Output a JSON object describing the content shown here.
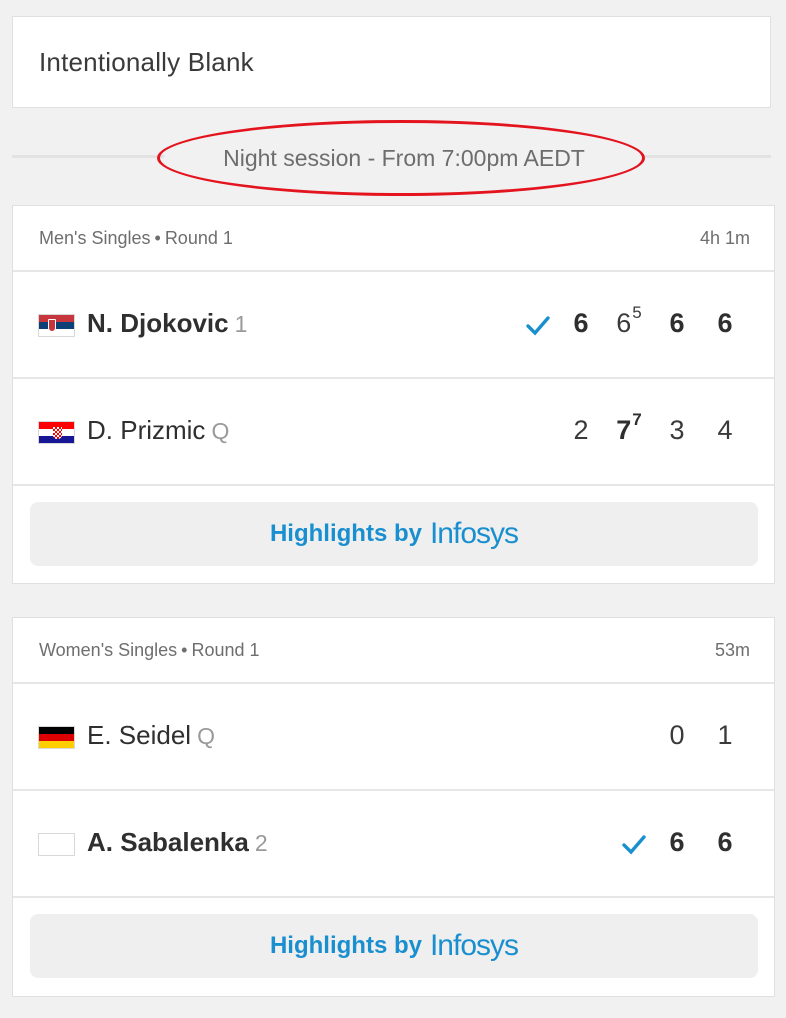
{
  "blank_card": {
    "text": "Intentionally Blank"
  },
  "session": {
    "label": "Night session - From 7:00pm AEDT"
  },
  "matches": [
    {
      "event": "Men's Singles",
      "round": "Round 1",
      "duration": "4h 1m",
      "players": [
        {
          "name": "N. Djokovic",
          "seed": "1",
          "country": "Serbia",
          "winner": true,
          "flag_colors": [
            "#c6363c",
            "#0c4076",
            "#ffffff"
          ],
          "sets": [
            {
              "games": "6",
              "tiebreak": ""
            },
            {
              "games": "6",
              "tiebreak": "5"
            },
            {
              "games": "6",
              "tiebreak": ""
            },
            {
              "games": "6",
              "tiebreak": ""
            }
          ],
          "set_won": [
            true,
            false,
            true,
            true
          ]
        },
        {
          "name": "D. Prizmic",
          "seed": "Q",
          "country": "Croatia",
          "winner": false,
          "flag_colors": [
            "#ff0000",
            "#ffffff",
            "#171796"
          ],
          "sets": [
            {
              "games": "2",
              "tiebreak": ""
            },
            {
              "games": "7",
              "tiebreak": "7"
            },
            {
              "games": "3",
              "tiebreak": ""
            },
            {
              "games": "4",
              "tiebreak": ""
            }
          ],
          "set_won": [
            false,
            true,
            false,
            false
          ]
        }
      ],
      "highlights": {
        "label": "Highlights by",
        "brand": "Infosys"
      }
    },
    {
      "event": "Women's Singles",
      "round": "Round 1",
      "duration": "53m",
      "players": [
        {
          "name": "E. Seidel",
          "seed": "Q",
          "country": "Germany",
          "winner": false,
          "flag_colors": [
            "#000000",
            "#dd0000",
            "#ffce00"
          ],
          "sets": [
            {
              "games": "0",
              "tiebreak": ""
            },
            {
              "games": "1",
              "tiebreak": ""
            }
          ],
          "set_won": [
            false,
            false
          ]
        },
        {
          "name": "A. Sabalenka",
          "seed": "2",
          "country": "Neutral",
          "winner": true,
          "flag_colors": [
            "#ffffff"
          ],
          "sets": [
            {
              "games": "6",
              "tiebreak": ""
            },
            {
              "games": "6",
              "tiebreak": ""
            }
          ],
          "set_won": [
            true,
            true
          ]
        }
      ],
      "highlights": {
        "label": "Highlights by",
        "brand": "Infosys"
      }
    }
  ],
  "colors": {
    "accent": "#1a8fd0",
    "annotation": "#e3141e"
  }
}
